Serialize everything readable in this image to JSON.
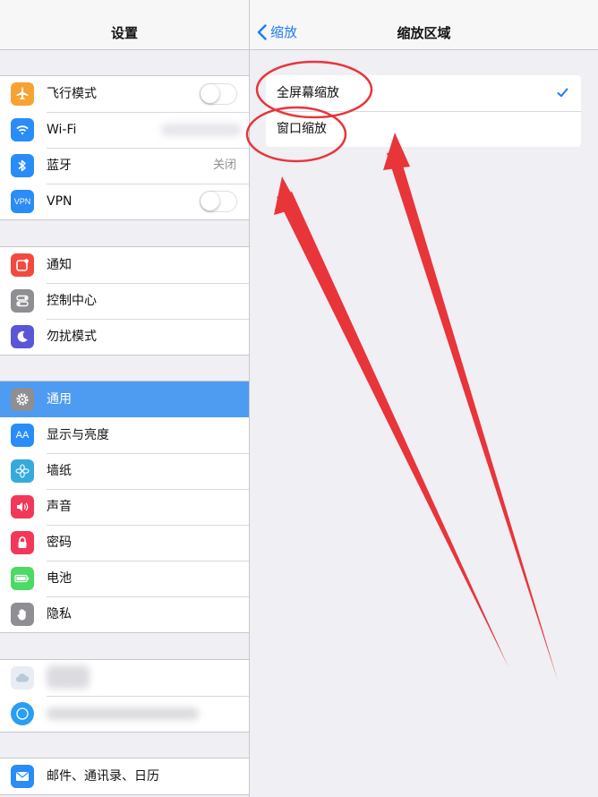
{
  "status_bar": {
    "battery_icon": "battery-icon"
  },
  "master": {
    "title": "设置",
    "groups": [
      {
        "rows": [
          {
            "label": "飞行模式",
            "icon": "airplane-icon",
            "color": "#f7a233",
            "accessory": "toggle",
            "toggle_on": false
          },
          {
            "label": "Wi-Fi",
            "icon": "wifi-icon",
            "color": "#2a8cf7",
            "accessory": "blurred-value"
          },
          {
            "label": "蓝牙",
            "icon": "bluetooth-icon",
            "color": "#2a8cf7",
            "value": "关闭"
          },
          {
            "label": "VPN",
            "icon": "vpn-icon",
            "icon_text": "VPN",
            "color": "#2a8cf7",
            "accessory": "toggle",
            "toggle_on": false
          }
        ]
      },
      {
        "rows": [
          {
            "label": "通知",
            "icon": "notifications-icon",
            "color": "#f24a3f"
          },
          {
            "label": "控制中心",
            "icon": "control-center-icon",
            "color": "#8e8e93"
          },
          {
            "label": "勿扰模式",
            "icon": "moon-icon",
            "color": "#5a57d6"
          }
        ]
      },
      {
        "rows": [
          {
            "label": "通用",
            "icon": "gear-icon",
            "color": "#8e8e93",
            "selected": true
          },
          {
            "label": "显示与亮度",
            "icon": "display-brightness-icon",
            "icon_text": "AA",
            "color": "#2a8cf7"
          },
          {
            "label": "墙纸",
            "icon": "wallpaper-icon",
            "color": "#37aadc"
          },
          {
            "label": "声音",
            "icon": "speaker-icon",
            "color": "#f2385a"
          },
          {
            "label": "密码",
            "icon": "lock-icon",
            "color": "#f2385a"
          },
          {
            "label": "电池",
            "icon": "battery-icon",
            "color": "#4cd964"
          },
          {
            "label": "隐私",
            "icon": "hand-icon",
            "color": "#8e8e93"
          }
        ]
      },
      {
        "rows": [
          {
            "label": "",
            "icon": "icloud-icon",
            "color": "#e8edf3",
            "blurred": true
          },
          {
            "label": "",
            "icon": "itunes-icon",
            "color": "#2a9df4",
            "blurred": true
          }
        ]
      },
      {
        "rows": [
          {
            "label": "邮件、通讯录、日历",
            "icon": "mail-icon",
            "color": "#2a8cf7"
          }
        ]
      }
    ]
  },
  "detail": {
    "back_label": "缩放",
    "title": "缩放区域",
    "options": [
      {
        "label": "全屏幕缩放",
        "checked": true
      },
      {
        "label": "窗口缩放",
        "checked": false
      }
    ]
  },
  "colors": {
    "accent": "#1f7cf2",
    "selected_row": "#4d9cf2",
    "annotation_red": "#e8353a"
  }
}
